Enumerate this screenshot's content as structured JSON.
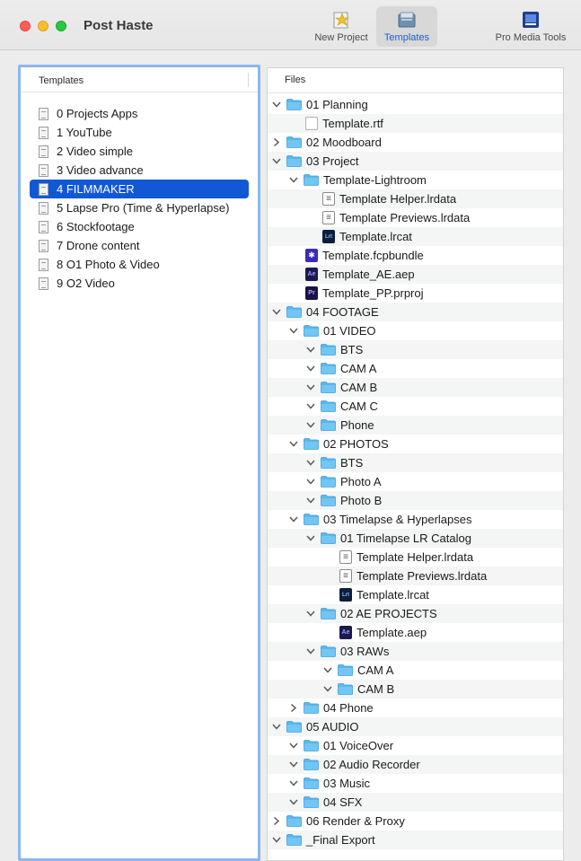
{
  "window": {
    "title": "Post Haste"
  },
  "toolbar": {
    "new_project": "New Project",
    "templates": "Templates",
    "pro_media_tools": "Pro Media Tools"
  },
  "templates_panel": {
    "header": "Templates",
    "selected_index": 4,
    "items": [
      "0 Projects Apps",
      "1 YouTube",
      "2 Video simple",
      "3 Video advance",
      "4 FILMMAKER",
      "5 Lapse Pro (Time & Hyperlapse)",
      "6 Stockfootage",
      "7 Drone content",
      "8 O1 Photo & Video",
      "9 O2 Video"
    ]
  },
  "files_panel": {
    "header": "Files",
    "rows": [
      {
        "depth": 0,
        "type": "folder",
        "expanded": true,
        "name": "01 Planning"
      },
      {
        "depth": 1,
        "type": "rtf",
        "name": "Template.rtf"
      },
      {
        "depth": 0,
        "type": "folder",
        "expanded": false,
        "name": "02 Moodboard"
      },
      {
        "depth": 0,
        "type": "folder",
        "expanded": true,
        "name": "03 Project"
      },
      {
        "depth": 1,
        "type": "folder",
        "expanded": true,
        "name": "Template-Lightroom"
      },
      {
        "depth": 2,
        "type": "lrdata",
        "name": "Template Helper.lrdata"
      },
      {
        "depth": 2,
        "type": "lrdata",
        "name": "Template Previews.lrdata"
      },
      {
        "depth": 2,
        "type": "lrcat",
        "name": "Template.lrcat"
      },
      {
        "depth": 1,
        "type": "fcp",
        "name": "Template.fcpbundle"
      },
      {
        "depth": 1,
        "type": "ae",
        "name": "Template_AE.aep"
      },
      {
        "depth": 1,
        "type": "pr",
        "name": "Template_PP.prproj"
      },
      {
        "depth": 0,
        "type": "folder",
        "expanded": true,
        "name": "04 FOOTAGE"
      },
      {
        "depth": 1,
        "type": "folder",
        "expanded": true,
        "name": "01 VIDEO"
      },
      {
        "depth": 2,
        "type": "folder",
        "expanded": true,
        "name": "BTS"
      },
      {
        "depth": 2,
        "type": "folder",
        "expanded": true,
        "name": "CAM A"
      },
      {
        "depth": 2,
        "type": "folder",
        "expanded": true,
        "name": "CAM B"
      },
      {
        "depth": 2,
        "type": "folder",
        "expanded": true,
        "name": "CAM C"
      },
      {
        "depth": 2,
        "type": "folder",
        "expanded": true,
        "name": "Phone"
      },
      {
        "depth": 1,
        "type": "folder",
        "expanded": true,
        "name": "02 PHOTOS"
      },
      {
        "depth": 2,
        "type": "folder",
        "expanded": true,
        "name": "BTS"
      },
      {
        "depth": 2,
        "type": "folder",
        "expanded": true,
        "name": "Photo A"
      },
      {
        "depth": 2,
        "type": "folder",
        "expanded": true,
        "name": "Photo B"
      },
      {
        "depth": 1,
        "type": "folder",
        "expanded": true,
        "name": "03 Timelapse & Hyperlapses"
      },
      {
        "depth": 2,
        "type": "folder",
        "expanded": true,
        "name": "01 Timelapse LR Catalog"
      },
      {
        "depth": 3,
        "type": "lrdata",
        "name": "Template Helper.lrdata"
      },
      {
        "depth": 3,
        "type": "lrdata",
        "name": "Template Previews.lrdata"
      },
      {
        "depth": 3,
        "type": "lrcat",
        "name": "Template.lrcat"
      },
      {
        "depth": 2,
        "type": "folder",
        "expanded": true,
        "name": "02 AE PROJECTS"
      },
      {
        "depth": 3,
        "type": "ae",
        "name": "Template.aep"
      },
      {
        "depth": 2,
        "type": "folder",
        "expanded": true,
        "name": "03 RAWs"
      },
      {
        "depth": 3,
        "type": "folder",
        "expanded": true,
        "name": "CAM A"
      },
      {
        "depth": 3,
        "type": "folder",
        "expanded": true,
        "name": "CAM B"
      },
      {
        "depth": 1,
        "type": "folder",
        "expanded": false,
        "name": "04 Phone"
      },
      {
        "depth": 0,
        "type": "folder",
        "expanded": true,
        "name": "05 AUDIO"
      },
      {
        "depth": 1,
        "type": "folder",
        "expanded": true,
        "name": "01 VoiceOver"
      },
      {
        "depth": 1,
        "type": "folder",
        "expanded": true,
        "name": "02 Audio Recorder"
      },
      {
        "depth": 1,
        "type": "folder",
        "expanded": true,
        "name": "03 Music"
      },
      {
        "depth": 1,
        "type": "folder",
        "expanded": true,
        "name": "04 SFX"
      },
      {
        "depth": 0,
        "type": "folder",
        "expanded": false,
        "name": "06 Render & Proxy"
      },
      {
        "depth": 0,
        "type": "folder",
        "expanded": true,
        "name": "_Final Export"
      }
    ]
  },
  "icon_labels": {
    "lrcat": "Lrt",
    "ae": "Ae",
    "pr": "Pr",
    "fcp": "✱",
    "rtf": ""
  },
  "colors": {
    "selection": "#1158d6",
    "folder": "#5bb8ee",
    "focus_ring": "#8ab7ee"
  }
}
